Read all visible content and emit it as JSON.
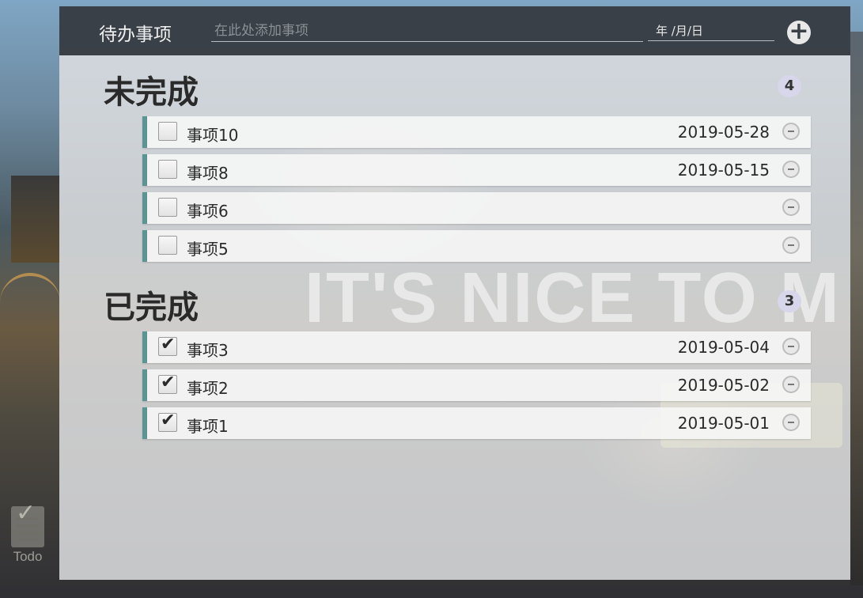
{
  "header": {
    "title": "待办事项",
    "input_placeholder": "在此处添加事项",
    "date_placeholder": "年 /月/日"
  },
  "watermark": "IT'S NICE TO M",
  "pending": {
    "title": "未完成",
    "count": "4",
    "items": [
      {
        "name": "事项10",
        "date": "2019-05-28"
      },
      {
        "name": "事项8",
        "date": "2019-05-15"
      },
      {
        "name": "事项6",
        "date": ""
      },
      {
        "name": "事项5",
        "date": ""
      }
    ]
  },
  "done": {
    "title": "已完成",
    "count": "3",
    "items": [
      {
        "name": "事项3",
        "date": "2019-05-04"
      },
      {
        "name": "事项2",
        "date": "2019-05-02"
      },
      {
        "name": "事项1",
        "date": "2019-05-01"
      }
    ]
  },
  "app_badge": {
    "label": "Todo"
  },
  "colors": {
    "accent": "#5c9494",
    "header_bg": "#32383e"
  }
}
